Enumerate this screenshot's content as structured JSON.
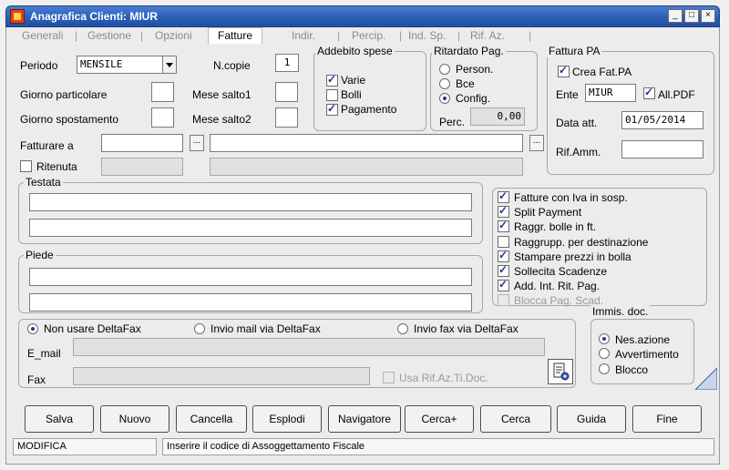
{
  "window": {
    "title": "Anagrafica Clienti: MIUR",
    "controls": [
      "minimize",
      "maximize",
      "close"
    ]
  },
  "tabs": {
    "generali": "Generali",
    "gestione": "Gestione",
    "opzioni": "Opzioni",
    "fatture": "Fatture",
    "indir": "Indir.",
    "percip": "Percip.",
    "ind_sp": "Ind. Sp.",
    "rif_az": "Rif. Az.",
    "separator": "|"
  },
  "fields": {
    "periodo_label": "Periodo",
    "periodo_value": "MENSILE",
    "ncopie_label": "N.copie",
    "ncopie_value": "1",
    "giorno_particolare_label": "Giorno particolare",
    "giorno_particolare_value": "",
    "mese_salto1_label": "Mese salto1",
    "mese_salto1_value": "",
    "giorno_spostamento_label": "Giorno spostamento",
    "giorno_spostamento_value": "",
    "mese_salto2_label": "Mese salto2",
    "mese_salto2_value": "",
    "fatturare_a_label": "Fatturare a",
    "fatturare_a_code": "",
    "fatturare_a_name": "",
    "ellipsis": "...",
    "ritenuta_label": "Ritenuta"
  },
  "addebito": {
    "title": "Addebito spese",
    "varie": "Varie",
    "bolli": "Bolli",
    "pagamento": "Pagamento"
  },
  "ritardato": {
    "title": "Ritardato Pag.",
    "person": "Person.",
    "bce": "Bce",
    "config": "Config.",
    "perc_label": "Perc.",
    "perc_value": "0,00"
  },
  "fattura_pa": {
    "title": "Fattura PA",
    "crea_label": "Crea Fat.PA",
    "ente_label": "Ente",
    "ente_value": "MIUR",
    "all_pdf_label": "All.PDF",
    "data_att_label": "Data att.",
    "data_att_value": "01/05/2014",
    "rif_amm_label": "Rif.Amm.",
    "rif_amm_value": ""
  },
  "testata": {
    "title": "Testata",
    "line1": "",
    "line2": ""
  },
  "piede": {
    "title": "Piede",
    "line1": "",
    "line2": ""
  },
  "options": {
    "fatture_iva_sosp": "Fatture con Iva in sosp.",
    "split_payment": "Split Payment",
    "raggr_bolle": "Raggr. bolle in ft.",
    "raggrupp_destinazione": "Raggrupp. per destinazione",
    "stampare_prezzi": "Stampare prezzi in bolla",
    "sollecita_scadenze": "Sollecita Scadenze",
    "add_int_rit": "Add. Int. Rit. Pag.",
    "blocca_pag": "Blocca Pag. Scad."
  },
  "deltafax": {
    "non_usare": "Non usare DeltaFax",
    "invio_mail": "Invio mail via DeltaFax",
    "invio_fax": "Invio fax via DeltaFax",
    "email_label": "E_mail",
    "email_value": "",
    "fax_label": "Fax",
    "fax_value": "",
    "usa_rif_label": "Usa Rif.Az.Ti.Doc."
  },
  "immis": {
    "title": "Immis. doc.",
    "nessuna": "Nes.azione",
    "avvertimento": "Avvertimento",
    "blocco": "Blocco"
  },
  "buttons": {
    "salva": "Salva",
    "nuovo": "Nuovo",
    "cancella": "Cancella",
    "esplodi": "Esplodi",
    "navigatore": "Navigatore",
    "cerca_plus": "Cerca+",
    "cerca": "Cerca",
    "guida": "Guida",
    "fine": "Fine"
  },
  "status": {
    "mode": "MODIFICA",
    "hint": "Inserire il codice di Assoggettamento Fiscale"
  },
  "colors": {
    "titlebar": "#2c5fb8",
    "accent_check": "#1a3a8a"
  }
}
